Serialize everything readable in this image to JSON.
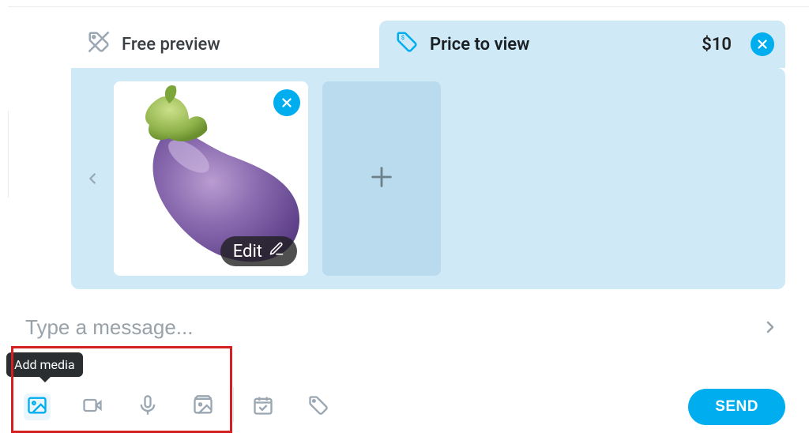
{
  "tabs": {
    "free": {
      "label": "Free preview"
    },
    "price": {
      "label": "Price to view",
      "amount": "$10"
    }
  },
  "media": {
    "edit_label": "Edit"
  },
  "composer": {
    "placeholder": "Type a message..."
  },
  "tooltip": {
    "add_media": "Add media"
  },
  "actions": {
    "send": "SEND"
  },
  "colors": {
    "accent": "#00aeef",
    "highlight": "#d32020"
  }
}
